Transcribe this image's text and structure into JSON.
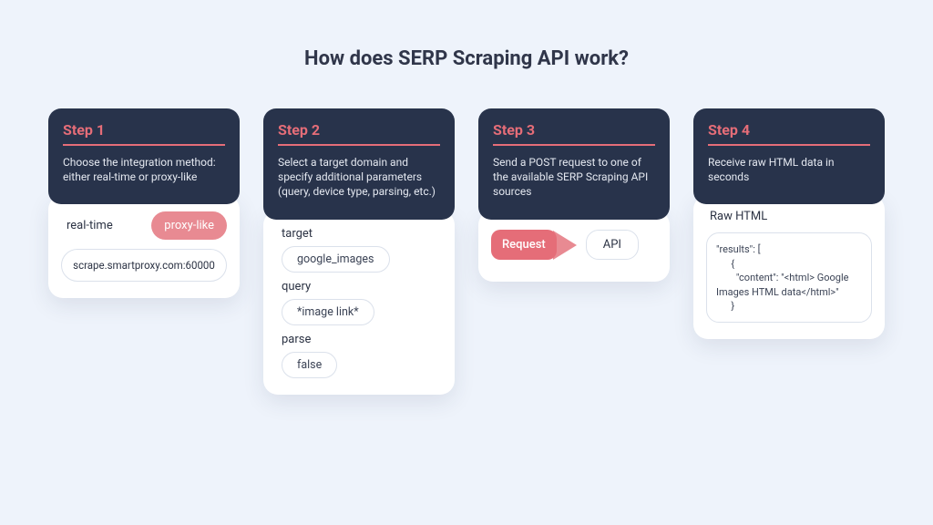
{
  "title": "How does SERP Scraping API work?",
  "steps": [
    {
      "label": "Step 1",
      "desc": "Choose the integration method: either real-time or proxy-like",
      "option_a": "real-time",
      "option_b": "proxy-like",
      "endpoint": "scrape.smartproxy.com:60000"
    },
    {
      "label": "Step 2",
      "desc": "Select a target domain and specify additional parameters (query, device type, parsing, etc.)",
      "params": {
        "target_label": "target",
        "target_value": "google_images",
        "query_label": "query",
        "query_value": "*image link*",
        "parse_label": "parse",
        "parse_value": "false"
      }
    },
    {
      "label": "Step 3",
      "desc": "Send a POST request to one of the available SERP Scraping API sources",
      "request_label": "Request",
      "api_label": "API"
    },
    {
      "label": "Step 4",
      "desc": "Receive raw HTML data in seconds",
      "raw_label": "Raw HTML",
      "code": "\"results\": [\n      {\n        \"content\": \"<html> Google Images HTML data</html>\"\n      }"
    }
  ]
}
